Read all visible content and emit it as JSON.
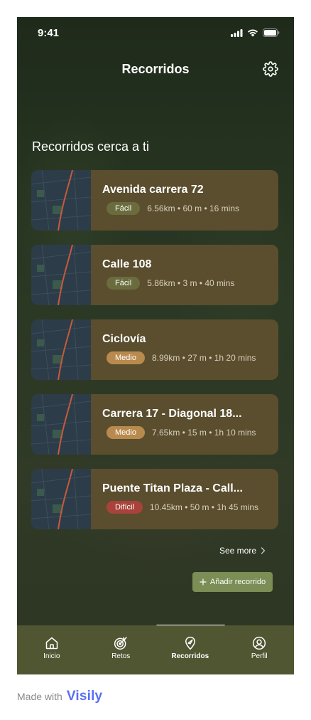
{
  "status_bar": {
    "time": "9:41"
  },
  "header": {
    "title": "Recorridos"
  },
  "section_title": "Recorridos cerca a ti",
  "routes": [
    {
      "name": "Avenida carrera 72",
      "difficulty": "Fácil",
      "stats": "6.56km • 60 m • 16 mins"
    },
    {
      "name": "Calle 108",
      "difficulty": "Fácil",
      "stats": "5.86km • 3 m • 40 mins"
    },
    {
      "name": "Ciclovía",
      "difficulty": "Medio",
      "stats": "8.99km • 27 m • 1h 20 mins"
    },
    {
      "name": "Carrera 17 - Diagonal 18...",
      "difficulty": "Medio",
      "stats": "7.65km • 15 m • 1h 10 mins"
    },
    {
      "name": "Puente Titan Plaza - Call...",
      "difficulty": "Difícil",
      "stats": "10.45km • 50 m • 1h 45 mins"
    }
  ],
  "see_more": "See more",
  "add_button": "Añadir recorrido",
  "tabs": [
    {
      "label": "Inicio",
      "icon": "home-icon"
    },
    {
      "label": "Retos",
      "icon": "target-icon"
    },
    {
      "label": "Recorridos",
      "icon": "map-pin-icon",
      "active": true
    },
    {
      "label": "Perfil",
      "icon": "user-icon"
    }
  ],
  "footer": {
    "made_with": "Made with",
    "brand": "Visily"
  },
  "colors": {
    "card": "#5a4e2e",
    "tab_bar": "#4f5631",
    "badge_facil": "#6a6c3e",
    "badge_medio": "#b98a4e",
    "badge_dificil": "#a8423a",
    "add_button": "#7c8d55",
    "visily": "#5b6ff2"
  }
}
